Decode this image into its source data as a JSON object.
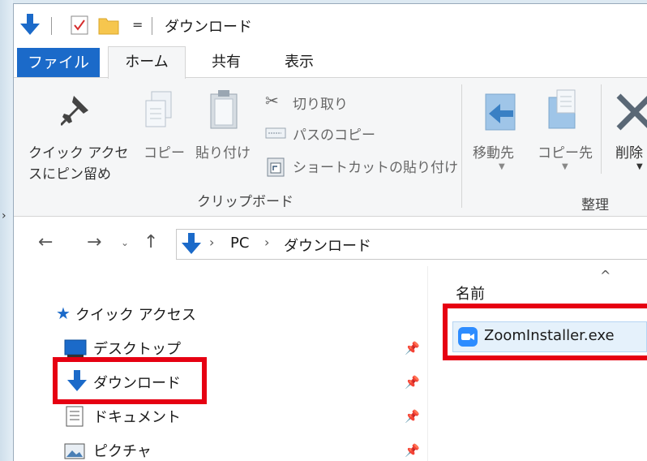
{
  "window": {
    "title": "ダウンロード"
  },
  "quick_access_toolbar": {
    "dropdown_glyph": "="
  },
  "tabs": {
    "file": "ファイル",
    "home": "ホーム",
    "share": "共有",
    "view": "表示"
  },
  "ribbon": {
    "pin_quick_access": {
      "line1": "クイック アクセ",
      "line2": "スにピン留め"
    },
    "copy": "コピー",
    "paste": "貼り付け",
    "cut": "切り取り",
    "copy_path": "パスのコピー",
    "paste_shortcut": "ショートカットの貼り付け",
    "group_clipboard": "クリップボード",
    "move_to": "移動先",
    "copy_to": "コピー先",
    "delete": "削除",
    "group_organize": "整理"
  },
  "address": {
    "segments": [
      "PC",
      "ダウンロード"
    ],
    "separator": "›"
  },
  "nav": {
    "quick_access": "クイック アクセス",
    "items": [
      {
        "label": "デスクトップ"
      },
      {
        "label": "ダウンロード"
      },
      {
        "label": "ドキュメント"
      },
      {
        "label": "ピクチャ"
      }
    ]
  },
  "file_list": {
    "column_name": "名前",
    "sort_indicator": "^",
    "files": [
      {
        "name": "ZoomInstaller.exe"
      }
    ]
  },
  "colors": {
    "accent": "#1b6ac9",
    "highlight": "#e60012",
    "selection": "#e5f1fb",
    "zoom_blue": "#2d8cff"
  }
}
